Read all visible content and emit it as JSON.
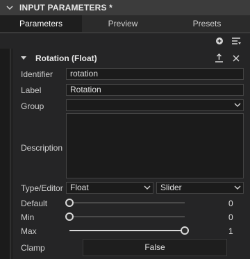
{
  "panel": {
    "title": "INPUT PARAMETERS *"
  },
  "tabs": [
    {
      "label": "Parameters"
    },
    {
      "label": "Preview"
    },
    {
      "label": "Presets"
    }
  ],
  "section": {
    "title": "Rotation (Float)"
  },
  "fields": {
    "identifier": {
      "label": "Identifier",
      "value": "rotation"
    },
    "label": {
      "label": "Label",
      "value": "Rotation"
    },
    "group": {
      "label": "Group",
      "value": ""
    },
    "description": {
      "label": "Description",
      "value": ""
    },
    "type_editor": {
      "label": "Type/Editor",
      "type_value": "Float",
      "editor_value": "Slider"
    },
    "default": {
      "label": "Default",
      "value": "0",
      "fraction": 0
    },
    "min": {
      "label": "Min",
      "value": "0",
      "fraction": 0
    },
    "max": {
      "label": "Max",
      "value": "1",
      "fraction": 1
    },
    "clamp": {
      "label": "Clamp",
      "value": "False"
    }
  },
  "icons": {
    "collapse": "chevron-down-icon",
    "add": "add-circle-icon",
    "menu": "list-menu-icon",
    "export": "export-icon",
    "close": "close-icon"
  },
  "colors": {
    "background": "#252526",
    "header": "#3c3c3c",
    "active_tab": "#1e1e1e",
    "field_bg": "#1b1b1b"
  }
}
